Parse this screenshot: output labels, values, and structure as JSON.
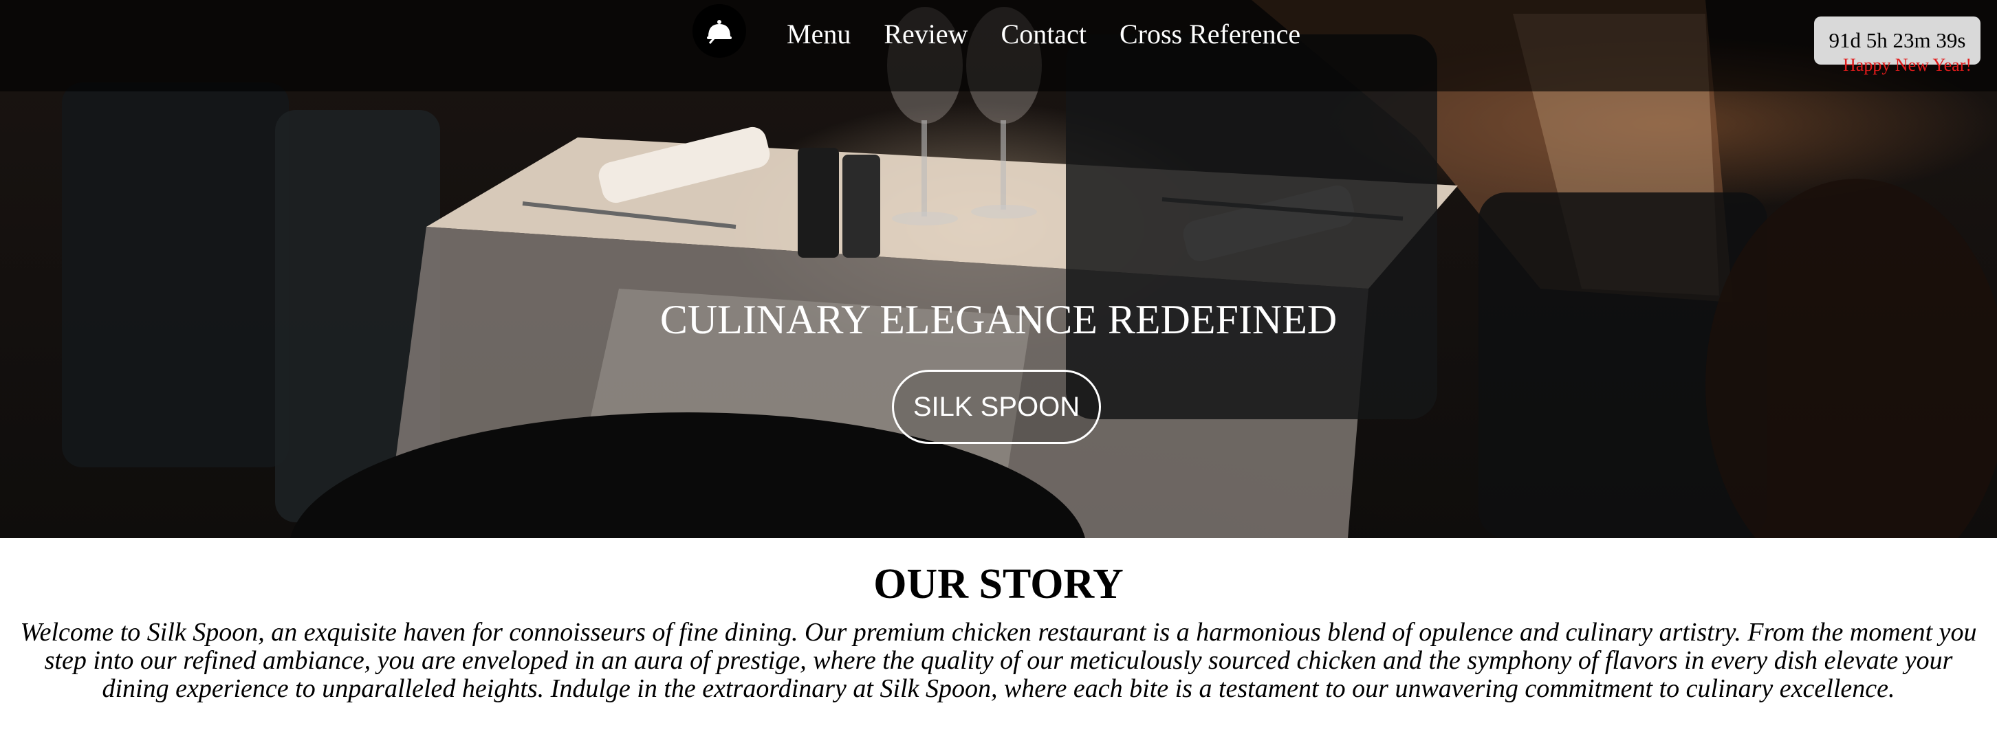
{
  "nav": {
    "logo_icon": "chef-cloche-icon",
    "links": [
      "Menu",
      "Review",
      "Contact",
      "Cross Reference"
    ]
  },
  "countdown": {
    "time": "91d 5h 23m 39s",
    "message": "Happy New Year!"
  },
  "hero": {
    "title": "CULINARY ELEGANCE REDEFINED",
    "button_label": "SILK SPOON"
  },
  "story": {
    "title": "OUR STORY",
    "text": "Welcome to Silk Spoon, an exquisite haven for connoisseurs of fine dining. Our premium chicken restaurant is a harmonious blend of opulence and culinary artistry. From the moment you step into our refined ambiance, you are enveloped in an aura of prestige, where the quality of our meticulously sourced chicken and the symphony of flavors in every dish elevate your dining experience to unparalleled heights. Indulge in the extraordinary at Silk Spoon, where each bite is a testament to our unwavering commitment to culinary excellence."
  },
  "colors": {
    "countdown_message": "#e21b1b",
    "countdown_bg": "#d9d9d9"
  }
}
